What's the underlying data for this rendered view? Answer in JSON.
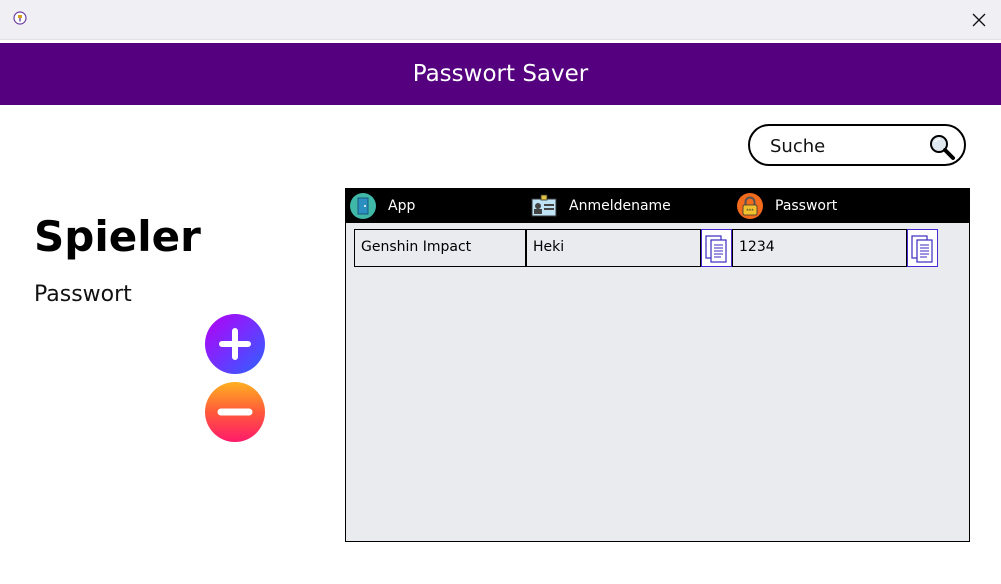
{
  "window": {
    "app_icon": "app-icon",
    "close_icon": "close-icon"
  },
  "header": {
    "title": "Passwort Saver",
    "color": "#54007f"
  },
  "search": {
    "placeholder": "Suche",
    "icon": "search-icon"
  },
  "profile": {
    "name": "Spieler",
    "password_label": "Passwort"
  },
  "actions": {
    "add_icon": "plus-icon",
    "remove_icon": "minus-icon"
  },
  "table": {
    "columns": [
      {
        "label": "App",
        "icon": "app-door-icon"
      },
      {
        "label": "Anmeldename",
        "icon": "id-card-icon"
      },
      {
        "label": "Passwort",
        "icon": "lock-icon"
      }
    ],
    "rows": [
      {
        "app": "Genshin Impact",
        "username": "Heki",
        "password": "1234"
      }
    ],
    "copy_icon": "copy-icon"
  }
}
